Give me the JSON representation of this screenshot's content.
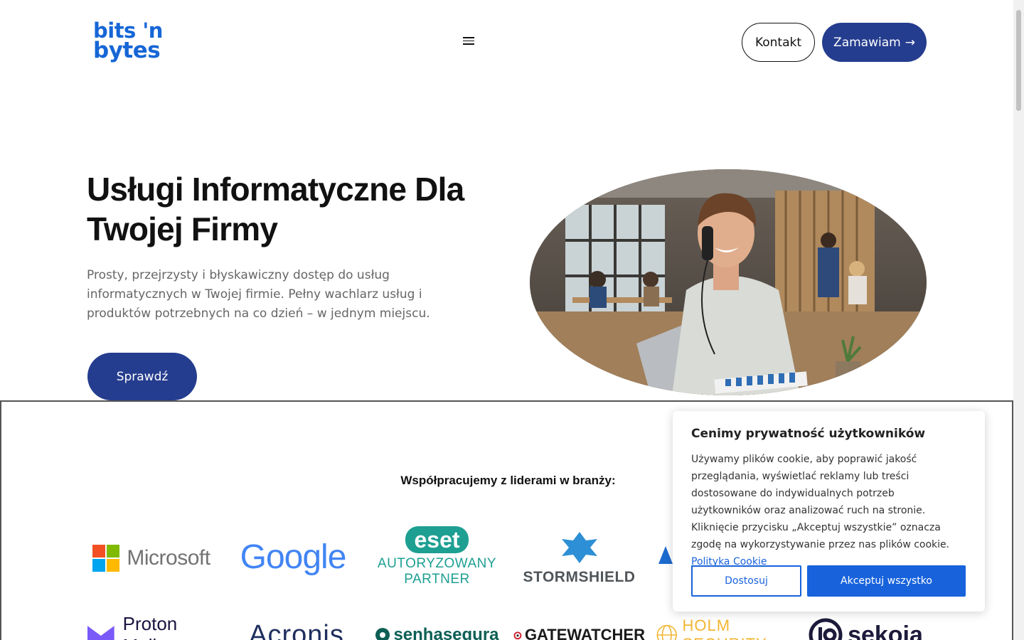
{
  "brand": {
    "logo_line1": "bits 'n",
    "logo_line2": "bytes",
    "color": "#1666d6"
  },
  "header": {
    "menu_icon": "hamburger-icon",
    "contact_label": "Kontakt",
    "order_label": "Zamawiam",
    "order_arrow": "→"
  },
  "hero": {
    "title_line1": "Usługi Informatyczne Dla",
    "title_line2": "Twojej Firmy",
    "description": "Prosty, przejrzysty i błyskawiczny dostęp do usług informatycznych w Twojej firmie. Pełny wachlarz usług i produktów potrzebnych na co dzień – w jednym miejscu.",
    "cta_label": "Sprawdź",
    "accent_color": "#253d8e"
  },
  "partners": {
    "title": "Współpracujemy z liderami w branży:",
    "row1": [
      "Microsoft",
      "Google",
      "eset",
      "AUTORYZOWANY",
      "PARTNER",
      "STORMSHIELD"
    ],
    "row2": [
      "Proton Mail",
      "Acronis",
      "senhasegura",
      "GATEWATCHER",
      "HOLM SECURITY",
      "sekoia"
    ]
  },
  "cookie": {
    "title": "Cenimy prywatność użytkowników",
    "text": "Używamy plików cookie, aby poprawić jakość przeglądania, wyświetlać reklamy lub treści dostosowane do indywidualnych potrzeb użytkowników oraz analizować ruch na stronie. Kliknięcie przycisku „Akceptuj wszystkie” oznacza zgodę na wykorzystywanie przez nas plików cookie.",
    "link_label": "Polityka Cookie",
    "customize_label": "Dostosuj",
    "accept_label": "Akceptuj wszystko",
    "button_color": "#1863dc"
  }
}
